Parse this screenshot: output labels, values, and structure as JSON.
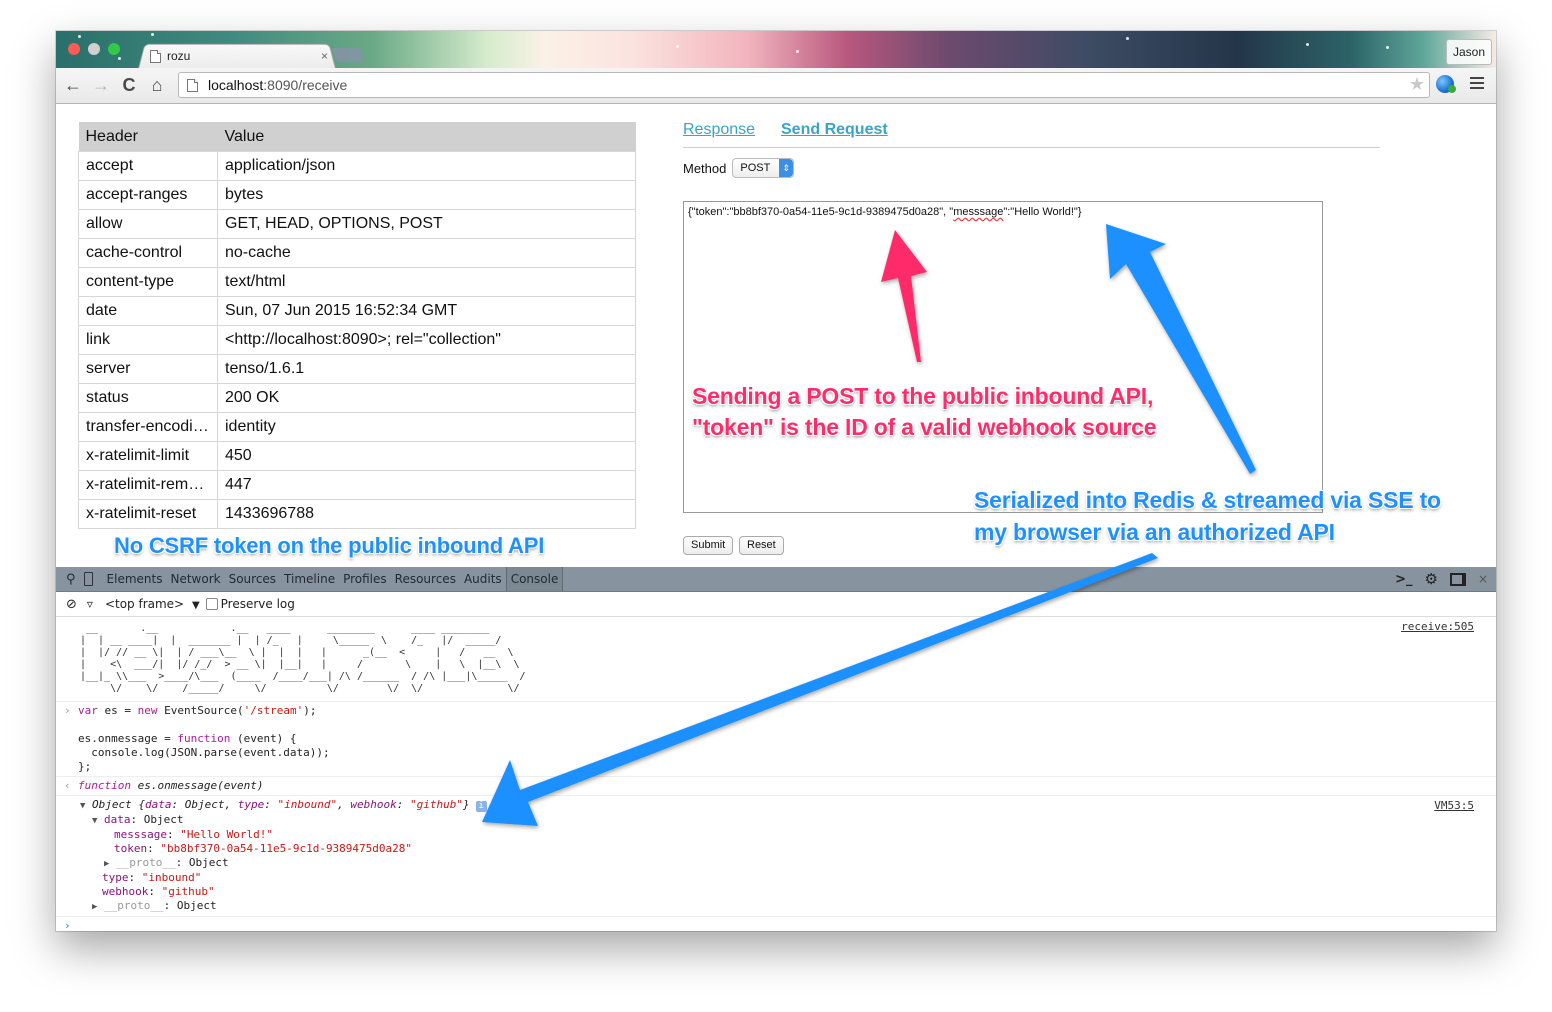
{
  "browser": {
    "tab_title": "rozu",
    "tab_close": "×",
    "profile_name": "Jason",
    "url_host": "localhost",
    "url_rest": ":8090/receive",
    "nav": {
      "back": "←",
      "forward": "→",
      "reload": "C",
      "home": "⌂"
    },
    "star": "★"
  },
  "headers_table": {
    "columns": [
      "Header",
      "Value"
    ],
    "rows": [
      [
        "accept",
        "application/json"
      ],
      [
        "accept-ranges",
        "bytes"
      ],
      [
        "allow",
        "GET, HEAD, OPTIONS, POST"
      ],
      [
        "cache-control",
        "no-cache"
      ],
      [
        "content-type",
        "text/html"
      ],
      [
        "date",
        "Sun, 07 Jun 2015 16:52:34 GMT"
      ],
      [
        "link",
        "<http://localhost:8090>; rel=\"collection\""
      ],
      [
        "server",
        "tenso/1.6.1"
      ],
      [
        "status",
        "200 OK"
      ],
      [
        "transfer-encodi…",
        "identity"
      ],
      [
        "x-ratelimit-limit",
        "450"
      ],
      [
        "x-ratelimit-rem…",
        "447"
      ],
      [
        "x-ratelimit-reset",
        "1433696788"
      ]
    ]
  },
  "request_panel": {
    "tabs": [
      {
        "label": "Response",
        "active": false
      },
      {
        "label": "Send Request",
        "active": true
      }
    ],
    "method_label": "Method",
    "method_value": "POST",
    "body_part1": "{\"token\":\"bb8bf370-0a54-11e5-9c1d-9389475d0a28\", \"",
    "body_misspelled": "messsage",
    "body_part2": "\":\"Hello World!\"}",
    "submit_label": "Submit",
    "reset_label": "Reset"
  },
  "annotations": {
    "csrf_note": "No CSRF token on the public inbound API",
    "post_note_line1": "Sending a POST to the public inbound API,",
    "post_note_line2": "\"token\" is the ID of a valid webhook source",
    "sse_note_line1": "Serialized into Redis & streamed via SSE to",
    "sse_note_line2": "my browser via an authorized API",
    "colors": {
      "pink": "#ff2c6a",
      "blue": "#1e90ff"
    }
  },
  "devtools": {
    "tabs": [
      "Elements",
      "Network",
      "Sources",
      "Timeline",
      "Profiles",
      "Resources",
      "Audits",
      "Console"
    ],
    "active_tab": "Console",
    "frame_selector": "<top frame>",
    "preserve_log_label": "Preserve log",
    "console": {
      "banner_source": "receive:505",
      "banner_ascii": " __       .__            .__   ____      ________      ____ ________\n|  | __ ____|  |  _______ |  | /_   |     \\_____  \\    /_   |/  _____/\n|  |/ // __ \\|  | / ___\\__  \\ |  |  |   |      _(__  <     |   /   __  \\\n|    <\\  ___/|  |/ /_/  > __ \\|  |__|   |     /       \\    |   \\  |__\\  \\\n|__|_ \\\\___  >____/\\___  (____  /____/___| /\\ /______  / /\\ |___|\\_____  /\n     \\/    \\/    /_____/     \\/          \\/        \\/  \\/              \\/",
      "input_lines": [
        {
          "parts": [
            {
              "t": "var",
              "c": "kw"
            },
            {
              "t": " es = ",
              "c": ""
            },
            {
              "t": "new",
              "c": "kw"
            },
            {
              "t": " EventSource(",
              "c": ""
            },
            {
              "t": "'/stream'",
              "c": "str"
            },
            {
              "t": ");",
              "c": ""
            }
          ]
        },
        {
          "parts": [
            {
              "t": " ",
              "c": ""
            }
          ]
        },
        {
          "parts": [
            {
              "t": "es.onmessage = ",
              "c": ""
            },
            {
              "t": "function",
              "c": "kw"
            },
            {
              "t": " (event) {",
              "c": ""
            }
          ]
        },
        {
          "parts": [
            {
              "t": "  console.log(JSON.parse(event.data));",
              "c": ""
            }
          ]
        },
        {
          "parts": [
            {
              "t": "};",
              "c": ""
            }
          ]
        }
      ],
      "return_value_kw": "function",
      "return_value_rest": " es.onmessage(event)",
      "object_source": "VM53:5",
      "object_summary": {
        "prefix": "Object {",
        "k1": "data",
        "v1": ": Object, ",
        "k2": "type",
        "v2": "\"inbound\"",
        "sep": ", ",
        "k3": "webhook",
        "v3": "\"github\"",
        "suffix": "}"
      },
      "object_tree": {
        "data_key": "data",
        "data_val": ": Object",
        "message_key": "messsage",
        "message_val": "\"Hello World!\"",
        "token_key": "token",
        "token_val": "\"bb8bf370-0a54-11e5-9c1d-9389475d0a28\"",
        "proto_key": "__proto__",
        "proto_val": ": Object",
        "type_key": "type",
        "type_val": "\"inbound\"",
        "webhook_key": "webhook",
        "webhook_val": "\"github\""
      },
      "prompt": "›"
    }
  }
}
